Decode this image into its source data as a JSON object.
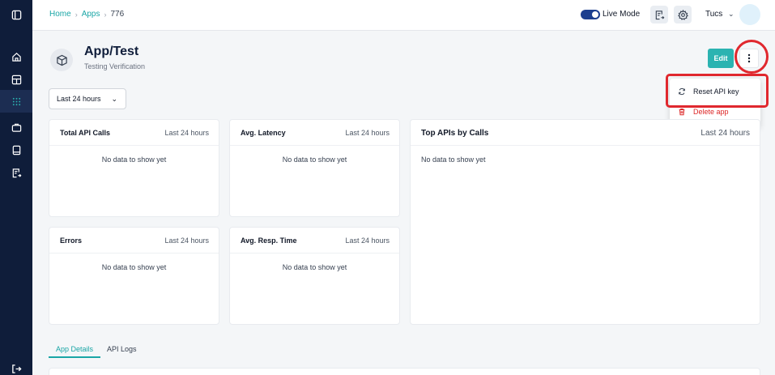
{
  "breadcrumb": {
    "home": "Home",
    "apps": "Apps",
    "current": "776",
    "sep": "›"
  },
  "header": {
    "live_mode_label": "Live Mode",
    "user_name": "Tucs",
    "user_chevron": "⌄"
  },
  "app": {
    "title": "App/Test",
    "subtitle": "Testing Verification"
  },
  "actions": {
    "edit_label": "Edit"
  },
  "menu": {
    "reset_api_key": "Reset API key",
    "delete_app": "Delete app"
  },
  "range_select": {
    "value": "Last 24 hours"
  },
  "cards": [
    {
      "title": "Total API Calls",
      "range": "Last 24 hours",
      "empty": "No data to show yet"
    },
    {
      "title": "Avg. Latency",
      "range": "Last 24 hours",
      "empty": "No data to show yet"
    },
    {
      "title": "Top APIs by Calls",
      "range": "Last 24 hours",
      "empty": "No data to show yet"
    },
    {
      "title": "Errors",
      "range": "Last 24 hours",
      "empty": "No data to show yet"
    },
    {
      "title": "Avg. Resp. Time",
      "range": "Last 24 hours",
      "empty": "No data to show yet"
    }
  ],
  "tabs": [
    {
      "label": "App Details"
    },
    {
      "label": "API Logs"
    }
  ],
  "colors": {
    "sidebar": "#0f1d3a",
    "accent": "#2bb3b1",
    "danger": "#dc2626",
    "highlight": "#e0282e"
  }
}
